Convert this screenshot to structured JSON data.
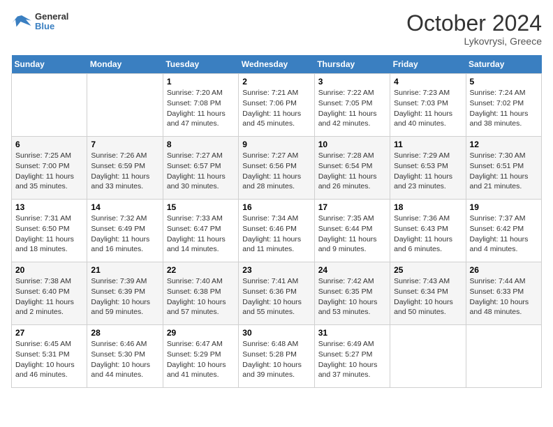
{
  "header": {
    "logo_line1": "General",
    "logo_line2": "Blue",
    "month": "October 2024",
    "location": "Lykovrysi, Greece"
  },
  "days_of_week": [
    "Sunday",
    "Monday",
    "Tuesday",
    "Wednesday",
    "Thursday",
    "Friday",
    "Saturday"
  ],
  "weeks": [
    [
      {
        "day": "",
        "sunrise": "",
        "sunset": "",
        "daylight": ""
      },
      {
        "day": "",
        "sunrise": "",
        "sunset": "",
        "daylight": ""
      },
      {
        "day": "1",
        "sunrise": "Sunrise: 7:20 AM",
        "sunset": "Sunset: 7:08 PM",
        "daylight": "Daylight: 11 hours and 47 minutes."
      },
      {
        "day": "2",
        "sunrise": "Sunrise: 7:21 AM",
        "sunset": "Sunset: 7:06 PM",
        "daylight": "Daylight: 11 hours and 45 minutes."
      },
      {
        "day": "3",
        "sunrise": "Sunrise: 7:22 AM",
        "sunset": "Sunset: 7:05 PM",
        "daylight": "Daylight: 11 hours and 42 minutes."
      },
      {
        "day": "4",
        "sunrise": "Sunrise: 7:23 AM",
        "sunset": "Sunset: 7:03 PM",
        "daylight": "Daylight: 11 hours and 40 minutes."
      },
      {
        "day": "5",
        "sunrise": "Sunrise: 7:24 AM",
        "sunset": "Sunset: 7:02 PM",
        "daylight": "Daylight: 11 hours and 38 minutes."
      }
    ],
    [
      {
        "day": "6",
        "sunrise": "Sunrise: 7:25 AM",
        "sunset": "Sunset: 7:00 PM",
        "daylight": "Daylight: 11 hours and 35 minutes."
      },
      {
        "day": "7",
        "sunrise": "Sunrise: 7:26 AM",
        "sunset": "Sunset: 6:59 PM",
        "daylight": "Daylight: 11 hours and 33 minutes."
      },
      {
        "day": "8",
        "sunrise": "Sunrise: 7:27 AM",
        "sunset": "Sunset: 6:57 PM",
        "daylight": "Daylight: 11 hours and 30 minutes."
      },
      {
        "day": "9",
        "sunrise": "Sunrise: 7:27 AM",
        "sunset": "Sunset: 6:56 PM",
        "daylight": "Daylight: 11 hours and 28 minutes."
      },
      {
        "day": "10",
        "sunrise": "Sunrise: 7:28 AM",
        "sunset": "Sunset: 6:54 PM",
        "daylight": "Daylight: 11 hours and 26 minutes."
      },
      {
        "day": "11",
        "sunrise": "Sunrise: 7:29 AM",
        "sunset": "Sunset: 6:53 PM",
        "daylight": "Daylight: 11 hours and 23 minutes."
      },
      {
        "day": "12",
        "sunrise": "Sunrise: 7:30 AM",
        "sunset": "Sunset: 6:51 PM",
        "daylight": "Daylight: 11 hours and 21 minutes."
      }
    ],
    [
      {
        "day": "13",
        "sunrise": "Sunrise: 7:31 AM",
        "sunset": "Sunset: 6:50 PM",
        "daylight": "Daylight: 11 hours and 18 minutes."
      },
      {
        "day": "14",
        "sunrise": "Sunrise: 7:32 AM",
        "sunset": "Sunset: 6:49 PM",
        "daylight": "Daylight: 11 hours and 16 minutes."
      },
      {
        "day": "15",
        "sunrise": "Sunrise: 7:33 AM",
        "sunset": "Sunset: 6:47 PM",
        "daylight": "Daylight: 11 hours and 14 minutes."
      },
      {
        "day": "16",
        "sunrise": "Sunrise: 7:34 AM",
        "sunset": "Sunset: 6:46 PM",
        "daylight": "Daylight: 11 hours and 11 minutes."
      },
      {
        "day": "17",
        "sunrise": "Sunrise: 7:35 AM",
        "sunset": "Sunset: 6:44 PM",
        "daylight": "Daylight: 11 hours and 9 minutes."
      },
      {
        "day": "18",
        "sunrise": "Sunrise: 7:36 AM",
        "sunset": "Sunset: 6:43 PM",
        "daylight": "Daylight: 11 hours and 6 minutes."
      },
      {
        "day": "19",
        "sunrise": "Sunrise: 7:37 AM",
        "sunset": "Sunset: 6:42 PM",
        "daylight": "Daylight: 11 hours and 4 minutes."
      }
    ],
    [
      {
        "day": "20",
        "sunrise": "Sunrise: 7:38 AM",
        "sunset": "Sunset: 6:40 PM",
        "daylight": "Daylight: 11 hours and 2 minutes."
      },
      {
        "day": "21",
        "sunrise": "Sunrise: 7:39 AM",
        "sunset": "Sunset: 6:39 PM",
        "daylight": "Daylight: 10 hours and 59 minutes."
      },
      {
        "day": "22",
        "sunrise": "Sunrise: 7:40 AM",
        "sunset": "Sunset: 6:38 PM",
        "daylight": "Daylight: 10 hours and 57 minutes."
      },
      {
        "day": "23",
        "sunrise": "Sunrise: 7:41 AM",
        "sunset": "Sunset: 6:36 PM",
        "daylight": "Daylight: 10 hours and 55 minutes."
      },
      {
        "day": "24",
        "sunrise": "Sunrise: 7:42 AM",
        "sunset": "Sunset: 6:35 PM",
        "daylight": "Daylight: 10 hours and 53 minutes."
      },
      {
        "day": "25",
        "sunrise": "Sunrise: 7:43 AM",
        "sunset": "Sunset: 6:34 PM",
        "daylight": "Daylight: 10 hours and 50 minutes."
      },
      {
        "day": "26",
        "sunrise": "Sunrise: 7:44 AM",
        "sunset": "Sunset: 6:33 PM",
        "daylight": "Daylight: 10 hours and 48 minutes."
      }
    ],
    [
      {
        "day": "27",
        "sunrise": "Sunrise: 6:45 AM",
        "sunset": "Sunset: 5:31 PM",
        "daylight": "Daylight: 10 hours and 46 minutes."
      },
      {
        "day": "28",
        "sunrise": "Sunrise: 6:46 AM",
        "sunset": "Sunset: 5:30 PM",
        "daylight": "Daylight: 10 hours and 44 minutes."
      },
      {
        "day": "29",
        "sunrise": "Sunrise: 6:47 AM",
        "sunset": "Sunset: 5:29 PM",
        "daylight": "Daylight: 10 hours and 41 minutes."
      },
      {
        "day": "30",
        "sunrise": "Sunrise: 6:48 AM",
        "sunset": "Sunset: 5:28 PM",
        "daylight": "Daylight: 10 hours and 39 minutes."
      },
      {
        "day": "31",
        "sunrise": "Sunrise: 6:49 AM",
        "sunset": "Sunset: 5:27 PM",
        "daylight": "Daylight: 10 hours and 37 minutes."
      },
      {
        "day": "",
        "sunrise": "",
        "sunset": "",
        "daylight": ""
      },
      {
        "day": "",
        "sunrise": "",
        "sunset": "",
        "daylight": ""
      }
    ]
  ]
}
